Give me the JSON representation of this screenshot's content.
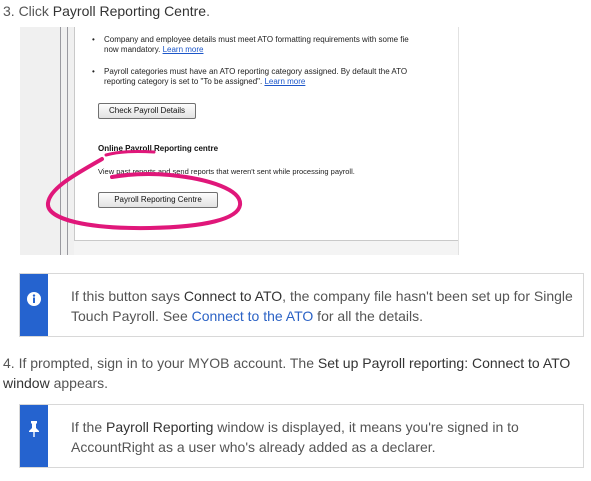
{
  "step3": {
    "prefix": "3. Click ",
    "emph": "Payroll Reporting Centre",
    "suffix": "."
  },
  "screenshot": {
    "bullet1": "Company and employee details must meet ATO formatting requirements with some fie",
    "bullet1_cont": "now mandatory.",
    "bullet1_link": "Learn more",
    "bullet2": "Payroll categories must have an ATO reporting category assigned. By default the ATO",
    "bullet2_cont": "reporting category is set to \"To be assigned\".",
    "bullet2_link": "Learn more",
    "check_button": "Check Payroll Details",
    "section_title": "Online Payroll Reporting centre",
    "section_desc": "View past reports and send reports that weren't sent while processing payroll.",
    "centre_button": "Payroll Reporting Centre",
    "annotation_color": "#e0177a"
  },
  "info": {
    "icon": "info-icon",
    "pre": "If this button says ",
    "emph": "Connect to ATO",
    "mid": ", the company file hasn't been set up for Single Touch Payroll. See ",
    "link": "Connect to the ATO",
    "post": " for all the details."
  },
  "step4": {
    "pre": "4. If prompted, sign in to your MYOB account. The ",
    "emph": "Set up Payroll reporting: Connect to ATO window",
    "post": " appears."
  },
  "tip": {
    "icon": "pin-icon",
    "pre": "If the ",
    "emph": "Payroll Reporting",
    "post": " window is displayed, it means you're signed in to AccountRight as a user who's already added as a declarer."
  },
  "colors": {
    "accent": "#2563cf",
    "link": "#2b62c5"
  }
}
